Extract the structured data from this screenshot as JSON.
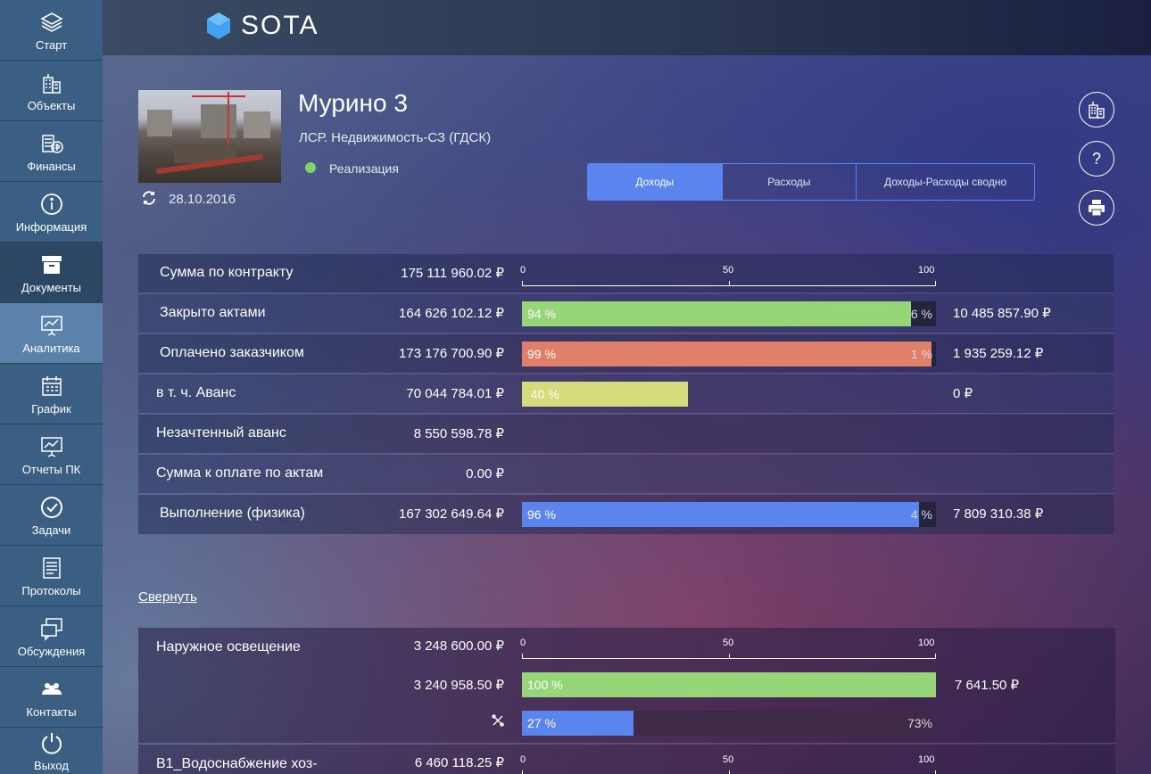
{
  "sidebar": {
    "items": [
      {
        "label": "Старт",
        "icon": "layers-icon"
      },
      {
        "label": "Объекты",
        "icon": "buildings-icon"
      },
      {
        "label": "Финансы",
        "icon": "money-icon"
      },
      {
        "label": "Информация",
        "icon": "info-icon"
      },
      {
        "label": "Документы",
        "icon": "box-icon"
      },
      {
        "label": "Аналитика",
        "icon": "presentation-chart-icon"
      },
      {
        "label": "График",
        "icon": "calendar-icon"
      },
      {
        "label": "Отчеты ПК",
        "icon": "presentation-icon"
      },
      {
        "label": "Задачи",
        "icon": "check-circle-icon"
      },
      {
        "label": "Протоколы",
        "icon": "document-list-icon"
      },
      {
        "label": "Обсуждения",
        "icon": "chat-icon"
      },
      {
        "label": "Контакты",
        "icon": "people-icon"
      },
      {
        "label": "Выход",
        "icon": "power-icon"
      }
    ]
  },
  "header": {
    "logo_text": "SOTA",
    "logo_color": "#3fa3f0"
  },
  "project": {
    "title": "Мурино 3",
    "company": "ЛСР. Недвижимость-СЗ (ГДСК)",
    "status": "Реализация",
    "status_color": "#7fd36b",
    "date": "28.10.2016"
  },
  "tabs": [
    {
      "label": "Доходы",
      "active": true
    },
    {
      "label": "Расходы",
      "active": false
    },
    {
      "label": "Доходы-Расходы сводно",
      "active": false
    }
  ],
  "action_buttons": [
    {
      "icon": "building-icon"
    },
    {
      "icon": "help-icon",
      "label": "?"
    },
    {
      "icon": "print-icon"
    }
  ],
  "scale_labels": [
    "0",
    "50",
    "100"
  ],
  "summary": [
    {
      "label": "Сумма по контракту",
      "amount": "175 111 960.02 ₽"
    },
    {
      "label": "Закрыто актами",
      "amount": "164 626 102.12 ₽",
      "pct": 94,
      "pct_label": "94 %",
      "rest_label": "6 %",
      "remain": "10 485 857.90 ₽",
      "color": "#97d678"
    },
    {
      "label": "Оплачено заказчиком",
      "amount": "173 176 700.90 ₽",
      "pct": 99,
      "pct_label": "99 %",
      "rest_label": "1 %",
      "remain": "1 935 259.12 ₽",
      "color": "#e0806a"
    },
    {
      "label": "в т. ч. Аванс",
      "amount": "70 044 784.01 ₽",
      "pct": 40,
      "pct_label": "40 %",
      "remain": "0 ₽",
      "color": "#d6dc7c"
    },
    {
      "label": "Незачтенный аванс",
      "amount": "8 550 598.78 ₽"
    },
    {
      "label": "Сумма к оплате по актам",
      "amount": "0.00 ₽"
    },
    {
      "label": "Выполнение (физика)",
      "amount": "167 302 649.64 ₽",
      "pct": 96,
      "pct_label": "96 %",
      "rest_label": "4 %",
      "remain": "7 809 310.38 ₽",
      "color": "#5b85ee"
    }
  ],
  "collapse_label": "Свернуть",
  "details": [
    {
      "label": "Наружное освещение",
      "amount": "3 248 600.00 ₽",
      "closed_amount": "3 240 958.50 ₽",
      "closed_pct": 100,
      "closed_pct_label": "100 %",
      "closed_remain": "7 641.50 ₽",
      "closed_color": "#97d678",
      "work_icon": "tools-icon",
      "work_pct": 27,
      "work_pct_label": "27 %",
      "work_rest_label": "73%",
      "work_color": "#5b85ee"
    },
    {
      "label": "В1_Водоснабжение хоз-",
      "amount": "6 460 118.25 ₽"
    }
  ]
}
